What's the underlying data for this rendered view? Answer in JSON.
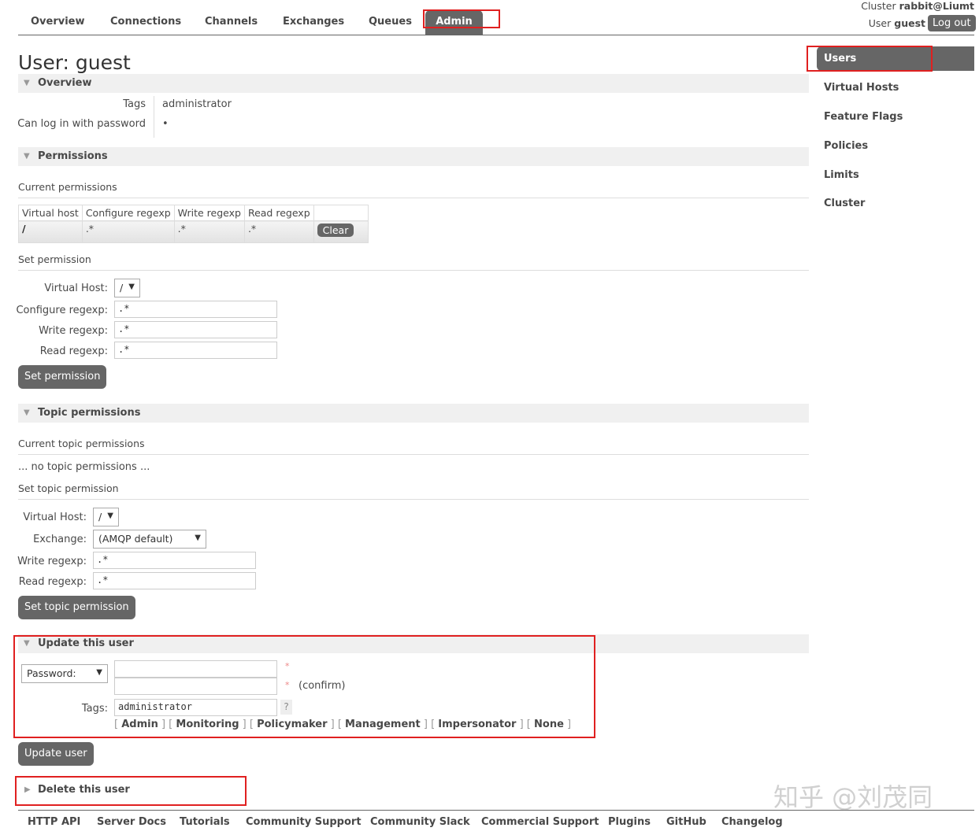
{
  "nav": {
    "tabs": [
      "Overview",
      "Connections",
      "Channels",
      "Exchanges",
      "Queues",
      "Admin"
    ],
    "active": "Admin"
  },
  "header": {
    "cluster_label": "Cluster",
    "cluster_name": "rabbit@Liumt",
    "user_label": "User",
    "user_name": "guest",
    "logout": "Log out"
  },
  "page_title": {
    "prefix": "User:",
    "name": "guest"
  },
  "overview": {
    "title": "Overview",
    "tags_label": "Tags",
    "tags_value": "administrator",
    "login_label": "Can log in with password",
    "login_value": "•"
  },
  "permissions": {
    "title": "Permissions",
    "current": "Current permissions",
    "columns": [
      "Virtual host",
      "Configure regexp",
      "Write regexp",
      "Read regexp"
    ],
    "rows": [
      {
        "vhost": "/",
        "configure": ".*",
        "write": ".*",
        "read": ".*",
        "action": "Clear"
      }
    ],
    "set_title": "Set permission",
    "vhost_label": "Virtual Host:",
    "vhost_value": "/",
    "configure_label": "Configure regexp:",
    "configure_value": ".*",
    "write_label": "Write regexp:",
    "write_value": ".*",
    "read_label": "Read regexp:",
    "read_value": ".*",
    "submit": "Set permission"
  },
  "topic": {
    "title": "Topic permissions",
    "current": "Current topic permissions",
    "empty": "... no topic permissions ...",
    "set_title": "Set topic permission",
    "vhost_label": "Virtual Host:",
    "vhost_value": "/",
    "exchange_label": "Exchange:",
    "exchange_value": "(AMQP default)",
    "write_label": "Write regexp:",
    "write_value": ".*",
    "read_label": "Read regexp:",
    "read_value": ".*",
    "submit": "Set topic permission"
  },
  "update": {
    "title": "Update this user",
    "password_select": "Password:",
    "required": "*",
    "confirm": "(confirm)",
    "tags_label": "Tags:",
    "tags_value": "administrator",
    "help": "?",
    "tag_options": [
      "Admin",
      "Monitoring",
      "Policymaker",
      "Management",
      "Impersonator",
      "None"
    ],
    "submit": "Update user"
  },
  "delete": {
    "title": "Delete this user"
  },
  "sidebar": {
    "items": [
      "Users",
      "Virtual Hosts",
      "Feature Flags",
      "Policies",
      "Limits",
      "Cluster"
    ],
    "active": "Users"
  },
  "footer": {
    "links": [
      "HTTP API",
      "Server Docs",
      "Tutorials",
      "Community Support",
      "Community Slack",
      "Commercial Support",
      "Plugins",
      "GitHub",
      "Changelog"
    ]
  },
  "watermark": "知乎 @刘茂同"
}
